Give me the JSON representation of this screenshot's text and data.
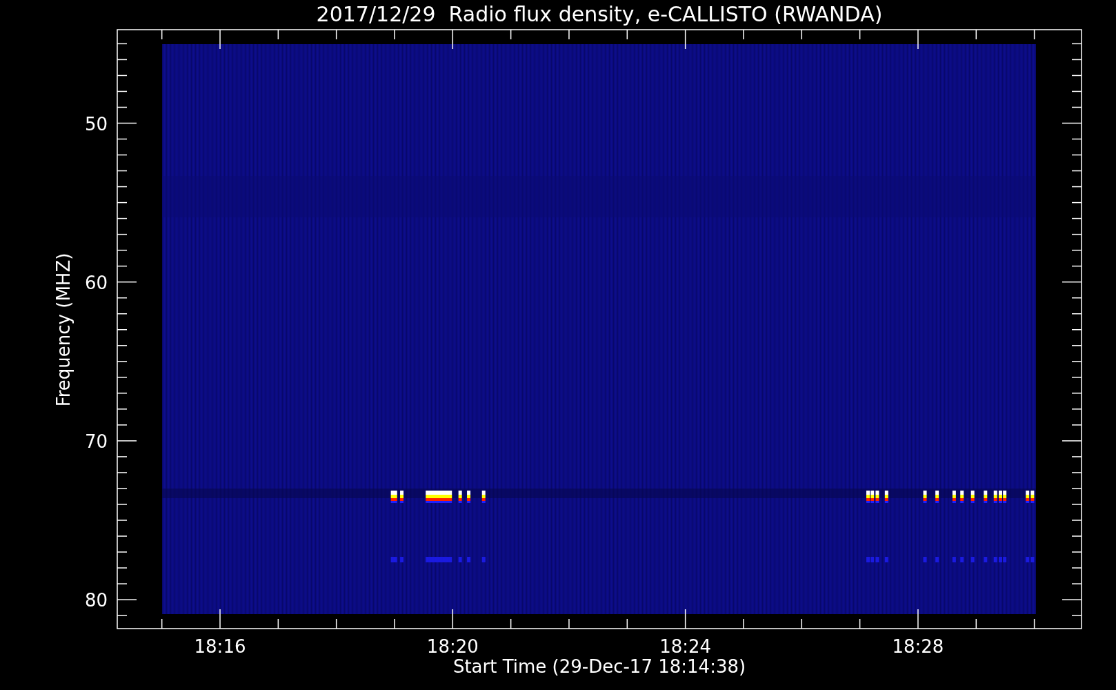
{
  "title": "2017/12/29  Radio flux density, e-CALLISTO (RWANDA)",
  "y_axis": {
    "label": "Frequency (MHZ)",
    "ticks": [
      "50",
      "60",
      "70",
      "80"
    ]
  },
  "x_axis": {
    "label": "Start Time (29-Dec-17 18:14:38)",
    "ticks": [
      "18:16",
      "18:20",
      "18:24",
      "18:28"
    ]
  }
}
